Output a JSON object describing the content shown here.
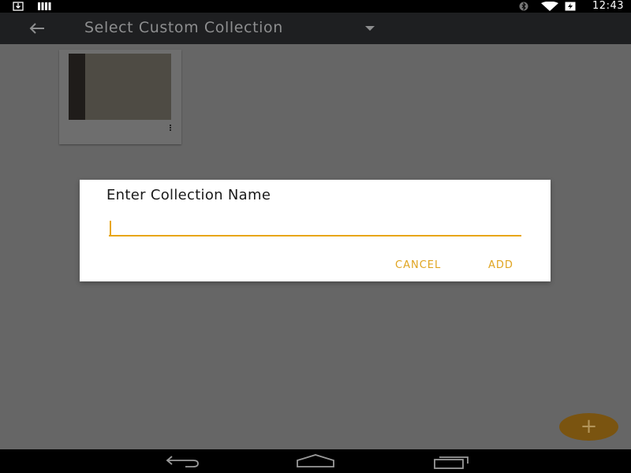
{
  "status_bar": {
    "time": "12:43",
    "icons": [
      "download-icon",
      "signal-bars-icon",
      "bluetooth-icon",
      "wifi-icon",
      "battery-charging-icon"
    ]
  },
  "app_bar": {
    "back_icon": "arrow-left-icon",
    "title": "Select Custom Collection",
    "dropdown_icon": "caret-down-icon"
  },
  "collection": {
    "menu_icon": "more-vert-icon"
  },
  "dialog": {
    "title": "Enter Collection Name",
    "input_value": "",
    "cancel_label": "CANCEL",
    "add_label": "ADD",
    "accent_color": "#e8a614"
  },
  "fab": {
    "label": "+",
    "color": "#7a5410"
  },
  "nav_bar": {
    "icons": [
      "nav-back-icon",
      "nav-home-icon",
      "nav-recents-icon"
    ]
  }
}
